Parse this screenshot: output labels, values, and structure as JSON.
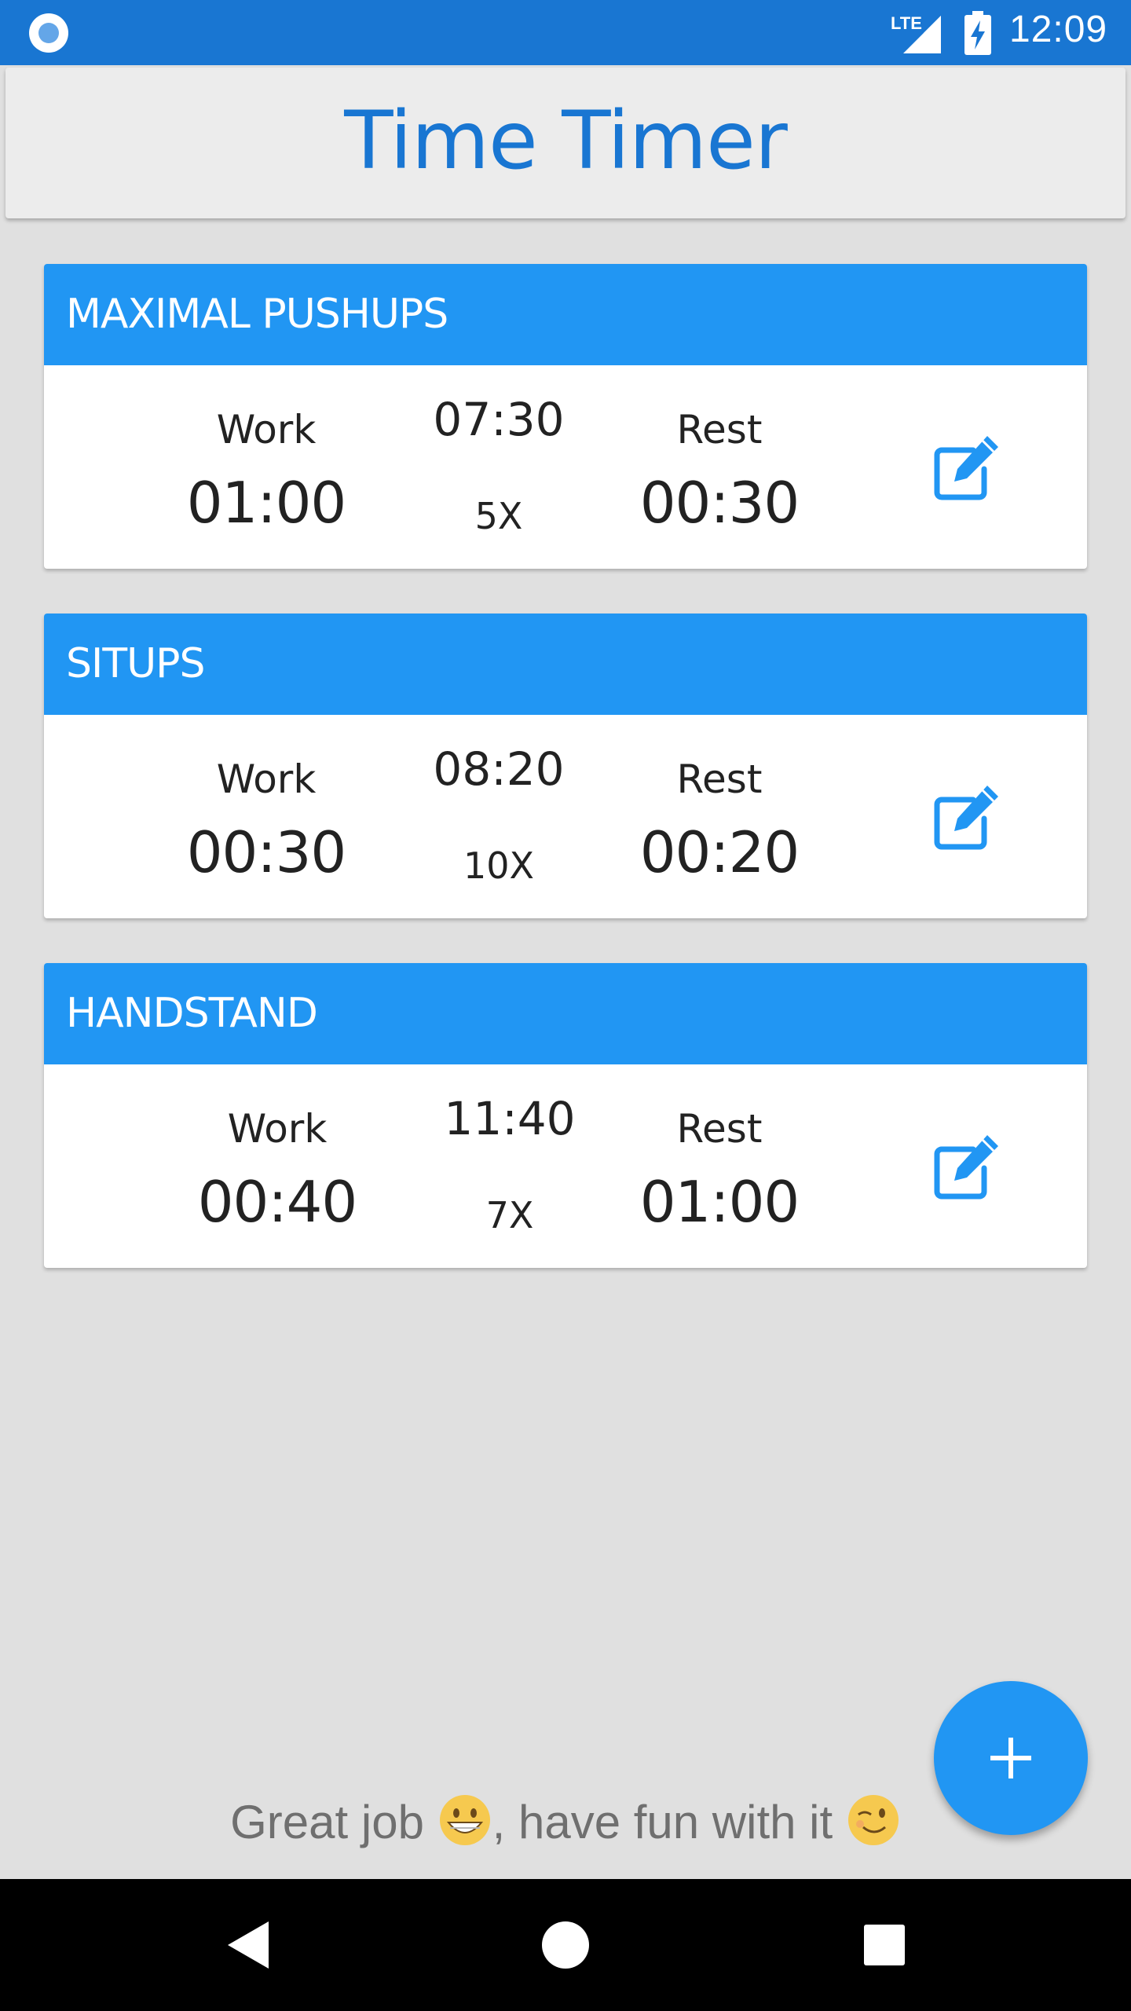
{
  "status_bar": {
    "network": "LTE",
    "time": "12:09",
    "icons": [
      "app-notification-icon",
      "signal-icon",
      "battery-charging-icon"
    ]
  },
  "app_bar": {
    "title": "Time Timer"
  },
  "workouts": [
    {
      "name": "MAXIMAL PUSHUPS",
      "work_label": "Work",
      "work": "01:00",
      "total": "07:30",
      "rounds": "5X",
      "rest_label": "Rest",
      "rest": "00:30"
    },
    {
      "name": "SITUPS",
      "work_label": "Work",
      "work": "00:30",
      "total": "08:20",
      "rounds": "10X",
      "rest_label": "Rest",
      "rest": "00:20"
    },
    {
      "name": "HANDSTAND",
      "work_label": "Work",
      "work": "00:40",
      "total": "11:40",
      "rounds": "7X",
      "rest_label": "Rest",
      "rest": "01:00"
    }
  ],
  "footer": {
    "part1": "Great job ",
    "part2": ", have fun with it ",
    "emoji1": "grinning-emoji",
    "emoji2": "winking-emoji"
  },
  "fab": {
    "icon": "plus-icon"
  },
  "nav_bar": {
    "icons": [
      "back-icon",
      "home-icon",
      "recents-icon"
    ]
  },
  "colors": {
    "primary_dark": "#1976d2",
    "primary": "#2196f3",
    "background": "#e0e0e0",
    "card": "#ffffff"
  }
}
